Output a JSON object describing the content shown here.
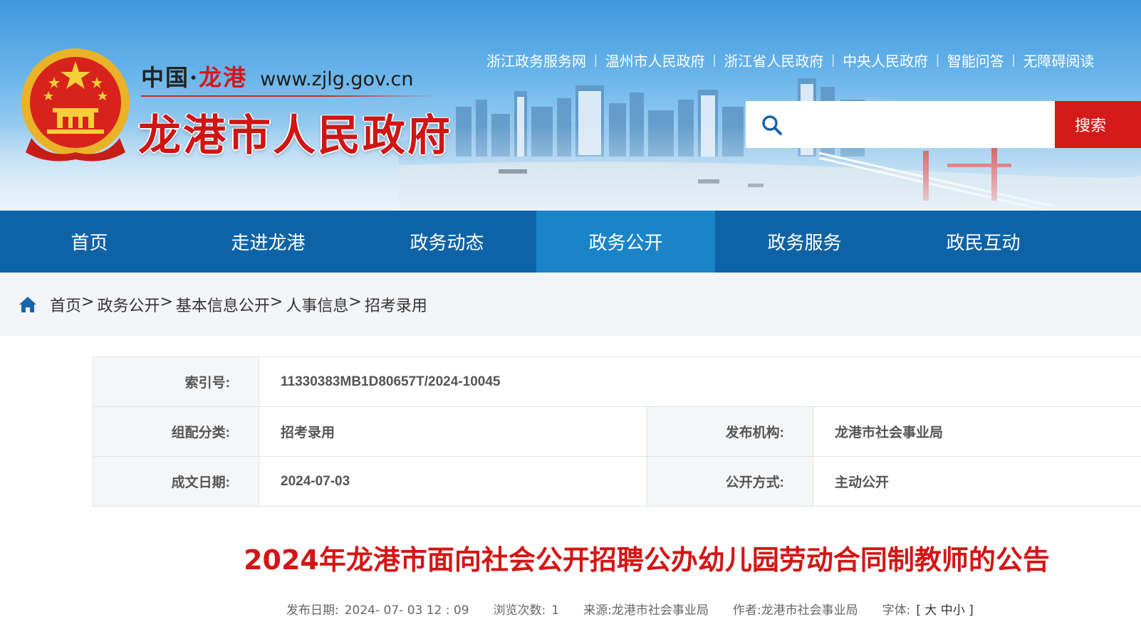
{
  "header": {
    "site_cn_prefix": "中国",
    "site_cn_dot": "·",
    "site_cn_city": "龙港",
    "site_url": "www.zjlg.gov.cn",
    "site_title": "龙港市人民政府",
    "emblem_icon": "national-emblem-icon",
    "top_links": [
      "浙江政务服务网",
      "温州市人民政府",
      "浙江省人民政府",
      "中央人民政府",
      "智能问答",
      "无障碍阅读"
    ],
    "search": {
      "placeholder": "",
      "button": "搜索",
      "icon": "search-icon"
    }
  },
  "nav": {
    "items": [
      "首页",
      "走进龙港",
      "政务动态",
      "政务公开",
      "政务服务",
      "政民互动"
    ],
    "active_index": 3
  },
  "breadcrumb": {
    "icon": "home-icon",
    "items": [
      "首页",
      "政务公开",
      "基本信息公开",
      "人事信息",
      "招考录用"
    ],
    "separator": ">"
  },
  "meta": {
    "index_label": "索引号:",
    "index_value": "11330383MB1D80657T/2024-10045",
    "category_label": "组配分类:",
    "category_value": "招考录用",
    "publisher_label": "发布机构:",
    "publisher_value": "龙港市社会事业局",
    "date_label": "成文日期:",
    "date_value": "2024-07-03",
    "disclosure_label": "公开方式:",
    "disclosure_value": "主动公开"
  },
  "article": {
    "title": "2024年龙港市面向社会公开招聘公办幼儿园劳动合同制教师的公告",
    "publish_label": "发布日期:",
    "publish_value": "2024- 07- 03 12 : 09",
    "views_label": "浏览次数:",
    "views_value": "1",
    "source_label": "来源:",
    "source_value": "龙港市社会事业局",
    "author_label": "作者:",
    "author_value": "龙港市社会事业局",
    "font_label": "字体:",
    "font_open": "[",
    "font_large": "大",
    "font_medium": "中",
    "font_small": "小",
    "font_close": "]"
  },
  "colors": {
    "nav_bg": "#0e63a6",
    "nav_active": "#1a84c9",
    "accent_red": "#d51a1a",
    "title_red": "#d41515"
  }
}
